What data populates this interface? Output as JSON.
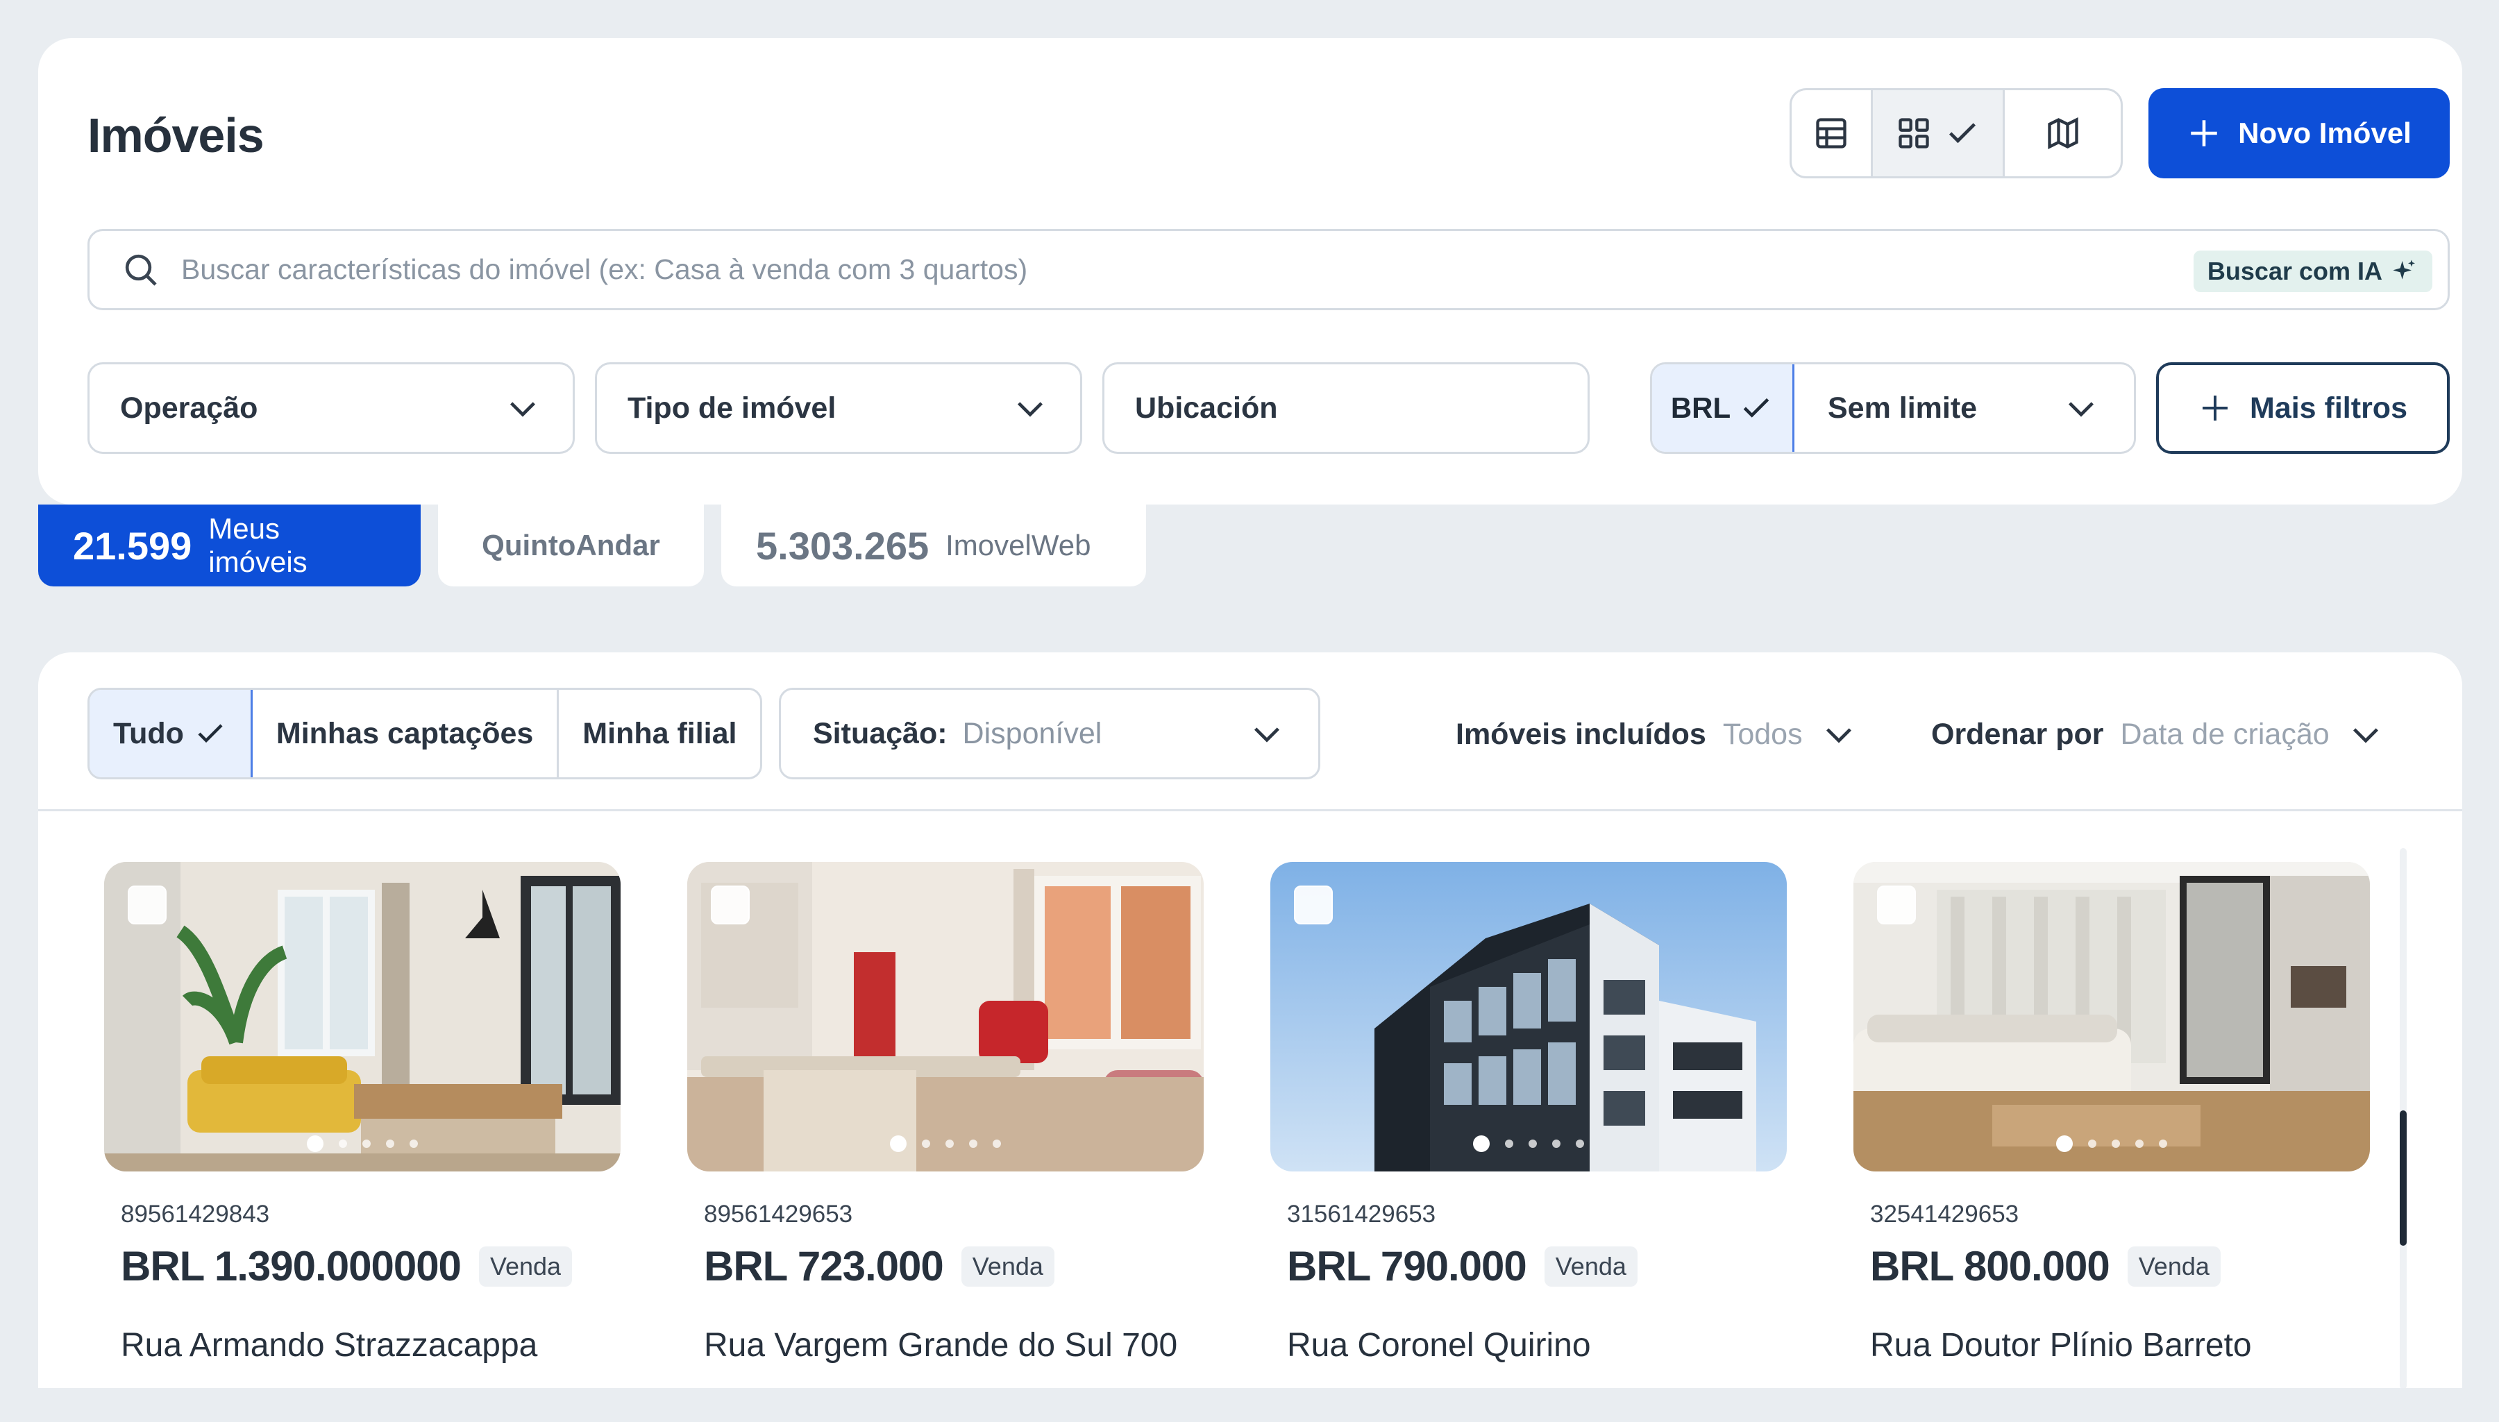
{
  "header": {
    "title": "Imóveis",
    "new_button": "Novo Imóvel"
  },
  "search": {
    "placeholder": "Buscar características do imóvel (ex: Casa à venda com 3 quartos)",
    "ai_button": "Buscar com IA"
  },
  "filters": {
    "operation": "Operação",
    "type": "Tipo de imóvel",
    "location": "Ubicación",
    "currency": "BRL",
    "limit": "Sem limite",
    "more": "Mais filtros"
  },
  "tabs": [
    {
      "count": "21.599",
      "label": "Meus imóveis"
    },
    {
      "count": "",
      "label": "QuintoAndar"
    },
    {
      "count": "5.303.265",
      "label": "ImovelWeb"
    }
  ],
  "list": {
    "segments": [
      "Tudo",
      "Minhas captações",
      "Minha filial"
    ],
    "situation_key": "Situação:",
    "situation_value": "Disponível",
    "included_key": "Imóveis incluídos",
    "included_value": "Todos",
    "sort_key": "Ordenar por",
    "sort_value": "Data de criação"
  },
  "properties": [
    {
      "code": "89561429843",
      "price": "BRL 1.390.000000",
      "badge": "Venda",
      "address": "Rua Armando Strazzacappa"
    },
    {
      "code": "89561429653",
      "price": "BRL 723.000",
      "badge": "Venda",
      "address": "Rua Vargem Grande do Sul 700"
    },
    {
      "code": "31561429653",
      "price": "BRL 790.000",
      "badge": "Venda",
      "address": "Rua Coronel Quirino"
    },
    {
      "code": "32541429653",
      "price": "BRL 800.000",
      "badge": "Venda",
      "address": "Rua Doutor Plínio Barreto"
    }
  ],
  "colors": {
    "primary": "#0d4fd8",
    "selected_bg": "#e8f0fd",
    "page_bg": "#e9edf1"
  }
}
